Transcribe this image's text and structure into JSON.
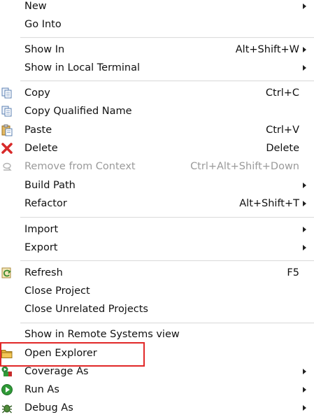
{
  "menu": {
    "items": [
      {
        "label": "New",
        "shortcut": "",
        "submenu": true,
        "disabled": false,
        "icon": ""
      },
      {
        "label": "Go Into",
        "shortcut": "",
        "submenu": false,
        "disabled": false,
        "icon": ""
      },
      {
        "label": "Show In",
        "shortcut": "Alt+Shift+W",
        "submenu": true,
        "disabled": false,
        "icon": ""
      },
      {
        "label": "Show in Local Terminal",
        "shortcut": "",
        "submenu": true,
        "disabled": false,
        "icon": ""
      },
      {
        "label": "Copy",
        "shortcut": "Ctrl+C",
        "submenu": false,
        "disabled": false,
        "icon": "copy-icon"
      },
      {
        "label": "Copy Qualified Name",
        "shortcut": "",
        "submenu": false,
        "disabled": false,
        "icon": "copy-qualified-name-icon"
      },
      {
        "label": "Paste",
        "shortcut": "Ctrl+V",
        "submenu": false,
        "disabled": false,
        "icon": "paste-icon"
      },
      {
        "label": "Delete",
        "shortcut": "Delete",
        "submenu": false,
        "disabled": false,
        "icon": "delete-x-icon"
      },
      {
        "label": "Remove from Context",
        "shortcut": "Ctrl+Alt+Shift+Down",
        "submenu": false,
        "disabled": true,
        "icon": "remove-from-context-icon"
      },
      {
        "label": "Build Path",
        "shortcut": "",
        "submenu": true,
        "disabled": false,
        "icon": ""
      },
      {
        "label": "Refactor",
        "shortcut": "Alt+Shift+T",
        "submenu": true,
        "disabled": false,
        "icon": ""
      },
      {
        "label": "Import",
        "shortcut": "",
        "submenu": true,
        "disabled": false,
        "icon": ""
      },
      {
        "label": "Export",
        "shortcut": "",
        "submenu": true,
        "disabled": false,
        "icon": ""
      },
      {
        "label": "Refresh",
        "shortcut": "F5",
        "submenu": false,
        "disabled": false,
        "icon": "refresh-icon"
      },
      {
        "label": "Close Project",
        "shortcut": "",
        "submenu": false,
        "disabled": false,
        "icon": ""
      },
      {
        "label": "Close Unrelated Projects",
        "shortcut": "",
        "submenu": false,
        "disabled": false,
        "icon": ""
      },
      {
        "label": "Show in Remote Systems view",
        "shortcut": "",
        "submenu": false,
        "disabled": false,
        "icon": ""
      },
      {
        "label": "Open Explorer",
        "shortcut": "",
        "submenu": false,
        "disabled": false,
        "icon": "folder-icon"
      },
      {
        "label": "Coverage As",
        "shortcut": "",
        "submenu": true,
        "disabled": false,
        "icon": "coverage-icon"
      },
      {
        "label": "Run As",
        "shortcut": "",
        "submenu": true,
        "disabled": false,
        "icon": "run-icon"
      },
      {
        "label": "Debug As",
        "shortcut": "",
        "submenu": true,
        "disabled": false,
        "icon": "debug-icon"
      }
    ]
  },
  "annotation": {
    "color": "#e12828",
    "target": "Open Explorer"
  }
}
